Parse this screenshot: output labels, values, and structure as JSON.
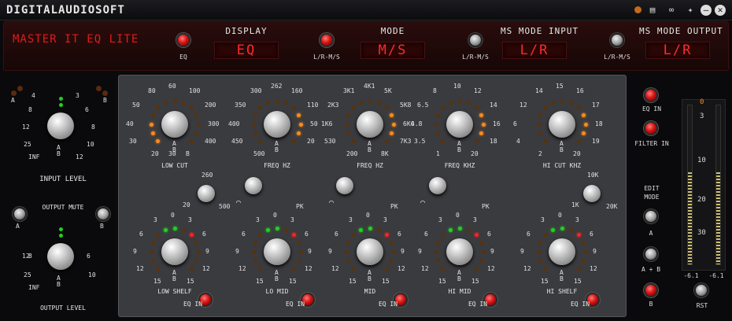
{
  "window": {
    "brand": "DIGITALAUDIOSOFT"
  },
  "header": {
    "product": "MASTER IT EQ LITE",
    "eq_btn": "EQ",
    "display": {
      "title": "DISPLAY",
      "btn": "L/R-M/S",
      "value": "EQ"
    },
    "mode": {
      "title": "MODE",
      "btn": "L/R-M/S",
      "value": "M/S"
    },
    "ms_in": {
      "title": "MS MODE INPUT",
      "btn": "L/R-M/S",
      "value": "L/R"
    },
    "ms_out": {
      "title": "MS MODE OUTPUT",
      "value": "L/R"
    }
  },
  "left": {
    "input_level": "INPUT LEVEL",
    "output_mute": "OUTPUT MUTE",
    "output_level": "OUTPUT LEVEL",
    "a": "A",
    "b": "B",
    "inf": "INF",
    "ticks": [
      "4",
      "3",
      "8",
      "6",
      "12",
      "8",
      "25",
      "10",
      "12",
      "6"
    ]
  },
  "bands_top": [
    {
      "name": "LOW CUT",
      "labels": [
        "60",
        "80",
        "100",
        "50",
        "200",
        "40",
        "300",
        "30",
        "400",
        "20",
        "B",
        "30"
      ]
    },
    {
      "name": "FREQ HZ",
      "labels": [
        "262",
        "300",
        "160",
        "350",
        "110",
        "400",
        "50",
        "450",
        "20",
        "500"
      ]
    },
    {
      "name": "FREQ HZ",
      "labels": [
        "4K1",
        "3K1",
        "5K",
        "2K3",
        "5K8",
        "1K6",
        "6K6",
        "530",
        "7K3",
        "200",
        "8K"
      ]
    },
    {
      "name": "FREQ KHZ",
      "labels": [
        "10",
        "8",
        "12",
        "6.5",
        "14",
        "4.8",
        "16",
        "3.5",
        "18",
        "1",
        "20"
      ]
    },
    {
      "name": "HI CUT KHZ",
      "labels": [
        "15",
        "14",
        "16",
        "12",
        "17",
        "6",
        "18",
        "4",
        "19",
        "2",
        "20"
      ]
    }
  ],
  "q_knobs": {
    "lo_q1": "260",
    "lo_q2": "20",
    "lo_q3": "500",
    "hi_q1": "10K",
    "hi_q2": "1K",
    "hi_q3": "20K",
    "pk": "PK"
  },
  "bands_bottom": [
    {
      "name": "LOW SHELF",
      "eq_in": "EQ IN"
    },
    {
      "name": "LO MID",
      "eq_in": "EQ IN"
    },
    {
      "name": "MID",
      "eq_in": "EQ IN"
    },
    {
      "name": "HI MID",
      "eq_in": "EQ IN"
    },
    {
      "name": "HI SHELF",
      "eq_in": "EQ IN"
    }
  ],
  "gain_ticks": {
    "t3": "3",
    "t0": "0",
    "t6": "6",
    "t9": "9",
    "t12": "12",
    "t15": "15",
    "b": "B"
  },
  "right": {
    "eq_in": "EQ IN",
    "filter_in": "FILTER IN",
    "edit_mode": "EDIT\nMODE",
    "a": "A",
    "ab": "A + B",
    "b": "B",
    "scale": [
      "0",
      "3",
      "10",
      "20",
      "30"
    ],
    "peak_l": "-6.1",
    "peak_r": "-6.1",
    "rst": "RST",
    "meter_level_l": 0.58,
    "meter_level_r": 0.58
  },
  "colors": {
    "led_red": "#ff2a2a",
    "led_orange": "#ff8a1a",
    "led_green": "#1fd21f"
  }
}
